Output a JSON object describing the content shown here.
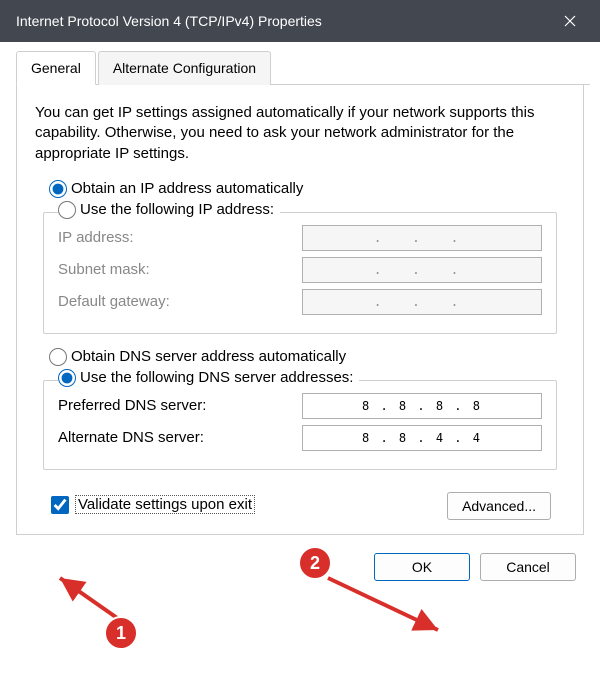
{
  "window": {
    "title": "Internet Protocol Version 4 (TCP/IPv4) Properties"
  },
  "tabs": {
    "general": "General",
    "alternate": "Alternate Configuration"
  },
  "intro": "You can get IP settings assigned automatically if your network supports this capability. Otherwise, you need to ask your network administrator for the appropriate IP settings.",
  "ip": {
    "auto_label": "Obtain an IP address automatically",
    "manual_label": "Use the following IP address:",
    "fields": {
      "ip_label": "IP address:",
      "mask_label": "Subnet mask:",
      "gw_label": "Default gateway:"
    }
  },
  "dns": {
    "auto_label": "Obtain DNS server address automatically",
    "manual_label": "Use the following DNS server addresses:",
    "fields": {
      "preferred_label": "Preferred DNS server:",
      "preferred_value": "8 . 8 . 8 . 8",
      "alternate_label": "Alternate DNS server:",
      "alternate_value": "8 . 8 . 4 . 4"
    }
  },
  "validate_label": "Validate settings upon exit",
  "buttons": {
    "advanced": "Advanced...",
    "ok": "OK",
    "cancel": "Cancel"
  },
  "annotations": {
    "badge1": "1",
    "badge2": "2"
  },
  "disabled_dots": ".   .   ."
}
